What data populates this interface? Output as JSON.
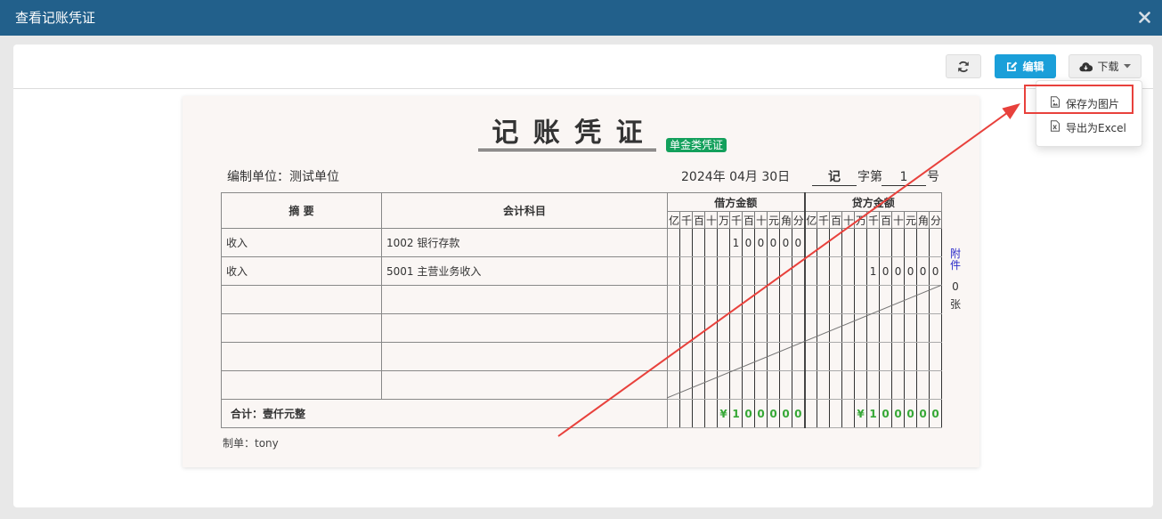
{
  "dialog": {
    "title": "查看记账凭证",
    "close_icon": "close-icon"
  },
  "toolbar": {
    "refresh_icon": "refresh-icon",
    "edit": {
      "label": "编辑",
      "icon": "edit-icon"
    },
    "download": {
      "label": "下载",
      "icon": "cloud-download-icon",
      "caret_icon": "caret-down-icon"
    },
    "download_menu": [
      {
        "label": "保存为图片",
        "icon": "image-file-icon"
      },
      {
        "label": "导出为Excel",
        "icon": "excel-file-icon"
      }
    ]
  },
  "voucher": {
    "title": "记 账 凭 证",
    "badge": "单金类凭证",
    "unit": "编制单位：测试单位",
    "date": "2024年 04月 30日",
    "word": "记",
    "word_suffix": "字第",
    "number": "1",
    "number_suffix": "号",
    "headers": {
      "summary": "摘 要",
      "account": "会计科目",
      "debit": "借方金额",
      "credit": "贷方金额",
      "digit_units": [
        "亿",
        "千",
        "百",
        "十",
        "万",
        "千",
        "百",
        "十",
        "元",
        "角",
        "分"
      ]
    },
    "rows": [
      {
        "summary": "收入",
        "account": "1002 银行存款",
        "debit": [
          "1",
          "0",
          "0",
          "0",
          "0",
          "0"
        ],
        "credit": []
      },
      {
        "summary": "收入",
        "account": "5001 主营业务收入",
        "debit": [],
        "credit": [
          "1",
          "0",
          "0",
          "0",
          "0",
          "0"
        ]
      },
      {
        "summary": "",
        "account": "",
        "debit": [],
        "credit": []
      },
      {
        "summary": "",
        "account": "",
        "debit": [],
        "credit": []
      },
      {
        "summary": "",
        "account": "",
        "debit": [],
        "credit": []
      },
      {
        "summary": "",
        "account": "",
        "debit": [],
        "credit": []
      }
    ],
    "total": {
      "label": "合计：壹仟元整",
      "debit": [
        "¥",
        "1",
        "0",
        "0",
        "0",
        "0",
        "0"
      ],
      "credit": [
        "¥",
        "1",
        "0",
        "0",
        "0",
        "0",
        "0"
      ]
    },
    "attachment": {
      "label": "附件",
      "count": "0",
      "unit": "张"
    },
    "maker": "制单：tony"
  },
  "colors": {
    "header_bar": "#22608b",
    "edit_button": "#1a9fd9",
    "badge": "#13a05c",
    "total_amount": "#36a836",
    "attachment_label": "#2929c9",
    "annotation": "#e8413c"
  }
}
